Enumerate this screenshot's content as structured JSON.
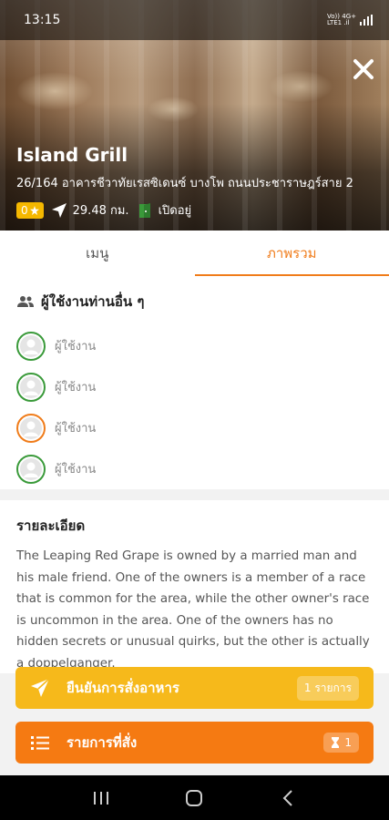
{
  "status_bar": {
    "time": "13:15",
    "network_top": "Vo)) 4G+",
    "network_bottom": "LTE1 .il"
  },
  "restaurant": {
    "name": "Island Grill",
    "address": "26/164 อาคารชีวาทัยเรสซิเดนซ์ บางโพ ถนนประชาราษฎร์สาย 2",
    "rating": "0",
    "distance": "29.48 กม.",
    "status": "เปิดอยู่"
  },
  "tabs": [
    {
      "label": "เมนู",
      "active": false
    },
    {
      "label": "ภาพรวม",
      "active": true
    }
  ],
  "users_section": {
    "title": "ผู้ใช้งานท่านอื่น ๆ",
    "users": [
      {
        "label": "ผู้ใช้งาน",
        "ring_color": "#3a9a3a"
      },
      {
        "label": "ผู้ใช้งาน",
        "ring_color": "#3a9a3a"
      },
      {
        "label": "ผู้ใช้งาน",
        "ring_color": "#f07c1a"
      },
      {
        "label": "ผู้ใช้งาน",
        "ring_color": "#3a9a3a"
      }
    ]
  },
  "details": {
    "title": "รายละเอียด",
    "text": "The Leaping Red Grape is owned by a married man and his male friend. One of the owners is a member of a race that is common for the area, while the other owner's race is uncommon in the area. One of the owners has no hidden secrets or unusual quirks, but the other is actually a doppelganger."
  },
  "buttons": {
    "confirm_label": "ยืนยันการสั่งอาหาร",
    "confirm_count": "1 รายการ",
    "list_label": "รายการที่สั่ง",
    "list_count": "1"
  },
  "colors": {
    "accent": "#f07c1a",
    "confirm": "#f6b91b",
    "list": "#f57a12",
    "rating": "#f5b800",
    "open": "#3a9a3a"
  }
}
